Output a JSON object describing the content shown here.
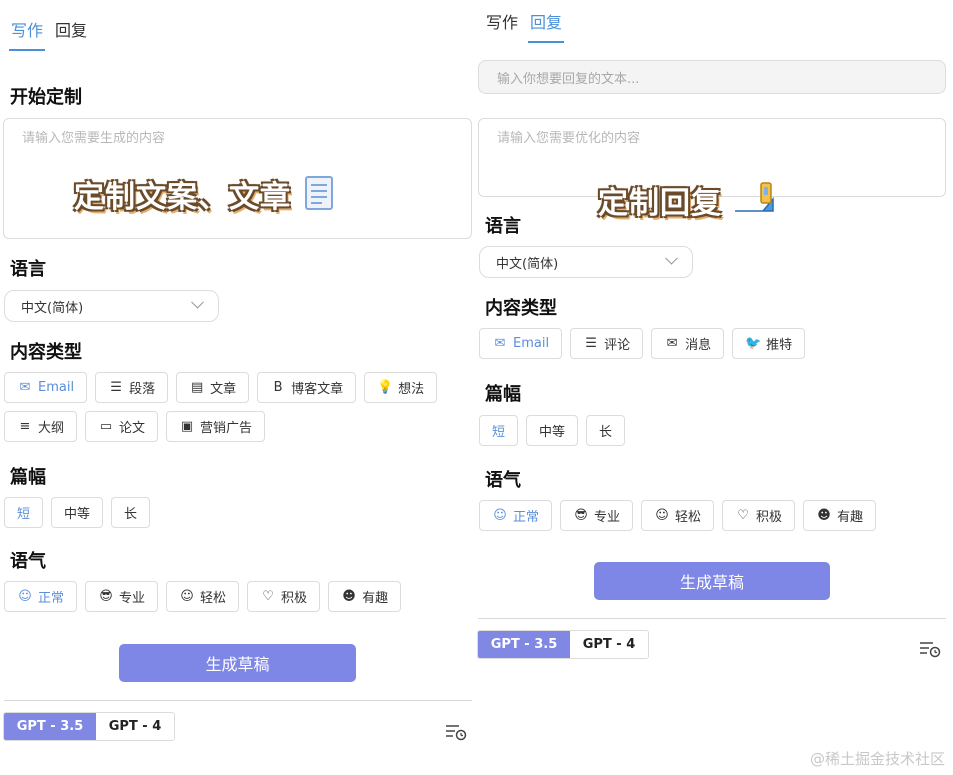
{
  "left": {
    "tabs": [
      {
        "label": "写作",
        "active": true
      },
      {
        "label": "回复",
        "active": false
      }
    ],
    "start_title": "开始定制",
    "prompt_placeholder": "请输入您需要生成的内容",
    "overlay_text": "定制文案、文章",
    "language_title": "语言",
    "language_value": "中文(简体)",
    "content_type_title": "内容类型",
    "content_types": [
      {
        "label": "Email",
        "icon": "✉",
        "icon_name": "envelope-icon",
        "selected": true
      },
      {
        "label": "段落",
        "icon": "☰",
        "icon_name": "paragraph-icon",
        "selected": false
      },
      {
        "label": "文章",
        "icon": "▤",
        "icon_name": "article-icon",
        "selected": false
      },
      {
        "label": "博客文章",
        "icon": "B",
        "icon_name": "blog-icon",
        "selected": false
      },
      {
        "label": "想法",
        "icon": "💡",
        "icon_name": "lightbulb-icon",
        "selected": false
      },
      {
        "label": "大纲",
        "icon": "≡",
        "icon_name": "outline-list-icon",
        "selected": false
      },
      {
        "label": "论文",
        "icon": "▭",
        "icon_name": "paper-icon",
        "selected": false
      },
      {
        "label": "营销广告",
        "icon": "▣",
        "icon_name": "ad-icon",
        "selected": false
      }
    ],
    "length_title": "篇幅",
    "lengths": [
      {
        "label": "短",
        "selected": true
      },
      {
        "label": "中等",
        "selected": false
      },
      {
        "label": "长",
        "selected": false
      }
    ],
    "tone_title": "语气",
    "tones": [
      {
        "label": "正常",
        "icon": "☺",
        "icon_name": "smile-icon",
        "selected": true
      },
      {
        "label": "专业",
        "icon": "😎",
        "icon_name": "sunglasses-icon",
        "selected": false
      },
      {
        "label": "轻松",
        "icon": "☺",
        "icon_name": "relaxed-face-icon",
        "selected": false
      },
      {
        "label": "积极",
        "icon": "♡",
        "icon_name": "heart-icon",
        "selected": false
      },
      {
        "label": "有趣",
        "icon": "☻",
        "icon_name": "fun-face-icon",
        "selected": false
      }
    ],
    "generate_label": "生成草稿",
    "models": [
      {
        "label": "GPT - 3.5",
        "active": true
      },
      {
        "label": "GPT - 4",
        "active": false
      }
    ]
  },
  "right": {
    "tabs": [
      {
        "label": "写作",
        "active": false
      },
      {
        "label": "回复",
        "active": true
      }
    ],
    "reply_placeholder": "输入你想要回复的文本...",
    "optimize_placeholder": "请输入您需要优化的内容",
    "overlay_text": "定制回复",
    "language_title": "语言",
    "language_value": "中文(简体)",
    "content_type_title": "内容类型",
    "content_types": [
      {
        "label": "Email",
        "icon": "✉",
        "icon_name": "envelope-icon",
        "selected": true
      },
      {
        "label": "评论",
        "icon": "☰",
        "icon_name": "comment-icon",
        "selected": false
      },
      {
        "label": "消息",
        "icon": "✉",
        "icon_name": "message-icon",
        "selected": false
      },
      {
        "label": "推特",
        "icon": "🐦",
        "icon_name": "twitter-icon",
        "selected": false
      }
    ],
    "length_title": "篇幅",
    "lengths": [
      {
        "label": "短",
        "selected": true
      },
      {
        "label": "中等",
        "selected": false
      },
      {
        "label": "长",
        "selected": false
      }
    ],
    "tone_title": "语气",
    "tones": [
      {
        "label": "正常",
        "icon": "☺",
        "icon_name": "smile-icon",
        "selected": true
      },
      {
        "label": "专业",
        "icon": "😎",
        "icon_name": "sunglasses-icon",
        "selected": false
      },
      {
        "label": "轻松",
        "icon": "☺",
        "icon_name": "relaxed-face-icon",
        "selected": false
      },
      {
        "label": "积极",
        "icon": "♡",
        "icon_name": "heart-icon",
        "selected": false
      },
      {
        "label": "有趣",
        "icon": "☻",
        "icon_name": "fun-face-icon",
        "selected": false
      }
    ],
    "generate_label": "生成草稿",
    "models": [
      {
        "label": "GPT - 3.5",
        "active": true
      },
      {
        "label": "GPT - 4",
        "active": false
      }
    ]
  },
  "watermark": "@稀土掘金技术社区",
  "colors": {
    "accent": "#4a90d9",
    "button": "#7e86e6",
    "model_active": "#8088e3"
  }
}
